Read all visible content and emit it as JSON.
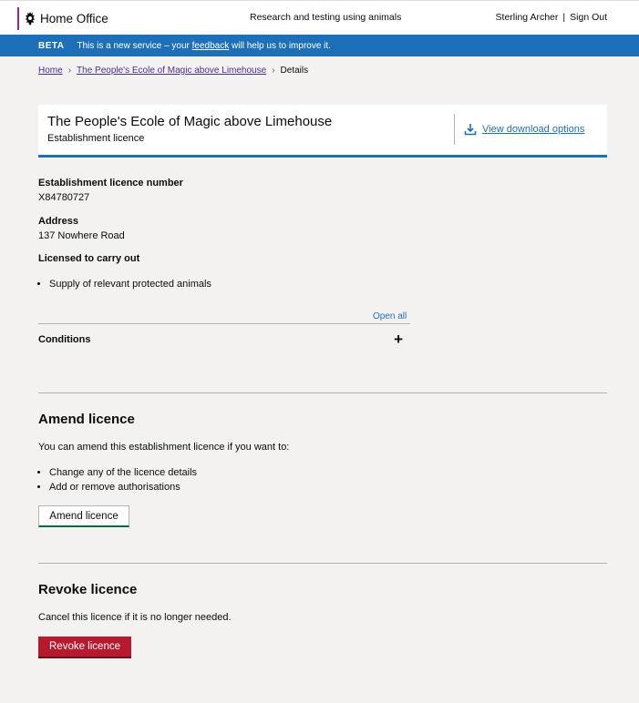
{
  "header": {
    "brand_name": "Home Office",
    "service_name": "Research and testing using animals",
    "user_name": "Sterling Archer",
    "separator": "|",
    "sign_out": "Sign Out"
  },
  "beta_banner": {
    "tag": "BETA",
    "text_before": "This is a new service – your ",
    "feedback_link": "feedback",
    "text_after": " will help us to improve it."
  },
  "breadcrumb": {
    "items": [
      "Home",
      "The People's Ecole of Magic above Limehouse"
    ],
    "current": "Details",
    "chevron": "›"
  },
  "title_panel": {
    "title": "The People's Ecole of Magic above Limehouse",
    "subtitle": "Establishment licence",
    "download_link": "View download options"
  },
  "details": {
    "licence_number_label": "Establishment licence number",
    "licence_number": "X84780727",
    "address_label": "Address",
    "address": "137 Nowhere Road",
    "licensed_label": "Licensed to carry out",
    "licensed_items": [
      "Supply of relevant protected animals"
    ]
  },
  "accordion": {
    "open_all": "Open all",
    "conditions_title": "Conditions",
    "expand_symbol": "+"
  },
  "amend": {
    "heading": "Amend licence",
    "intro": "You can amend this establishment licence if you want to:",
    "items": [
      "Change any of the licence details",
      "Add or remove authorisations"
    ],
    "button": "Amend licence"
  },
  "revoke": {
    "heading": "Revoke licence",
    "intro": "Cancel this licence if it is no longer needed.",
    "button": "Revoke licence"
  },
  "colors": {
    "accent_blue": "#1d70b8",
    "brand_purple": "#8f23b3",
    "warning_red": "#b7192f",
    "visited_link": "#4c2c92"
  }
}
